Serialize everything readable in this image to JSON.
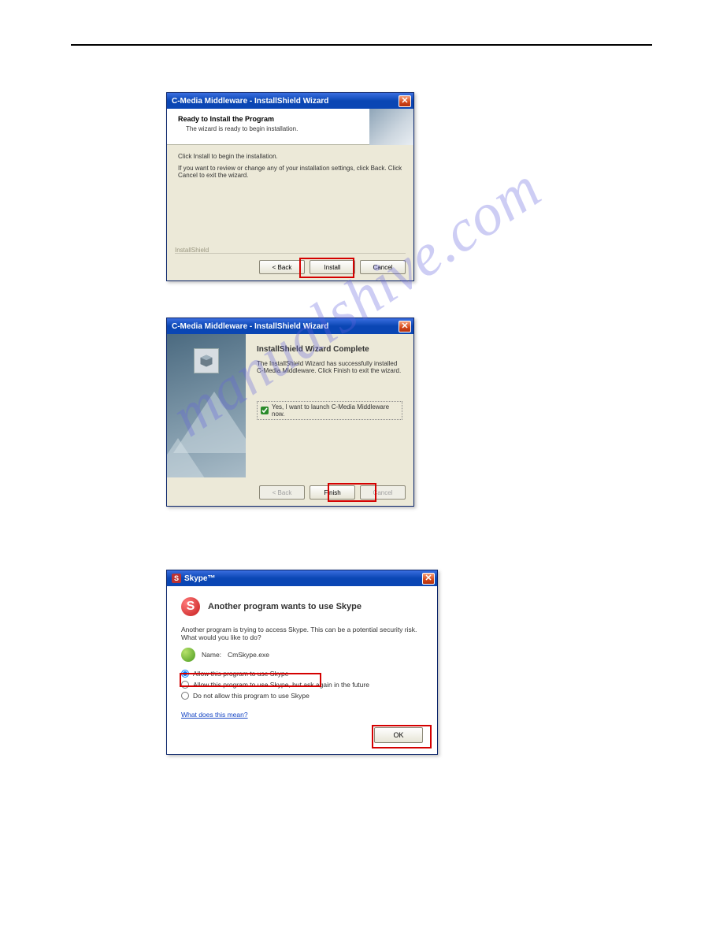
{
  "watermark": "manualshive.com",
  "dialog1": {
    "title": "C-Media Middleware - InstallShield Wizard",
    "heading": "Ready to Install the Program",
    "subheading": "The wizard is ready to begin installation.",
    "line1": "Click Install to begin the installation.",
    "line2": "If you want to review or change any of your installation settings, click Back. Click Cancel to exit the wizard.",
    "brand": "InstallShield",
    "btn_back": "< Back",
    "btn_install": "Install",
    "btn_cancel": "Cancel"
  },
  "dialog2": {
    "title": "C-Media Middleware - InstallShield Wizard",
    "heading": "InstallShield Wizard Complete",
    "body": "The InstallShield Wizard has successfully installed C-Media Middleware. Click Finish to exit the wizard.",
    "checkbox_label": "Yes, I want to launch C-Media Middleware now.",
    "btn_back": "< Back",
    "btn_finish": "Finish",
    "btn_cancel": "Cancel"
  },
  "dialog3": {
    "title": "Skype™",
    "heading": "Another program wants to use Skype",
    "intro1": "Another program is trying to access Skype. This can be a potential security risk.",
    "intro2": "What would you like to do?",
    "name_label": "Name:",
    "name_value": "CmSkype.exe",
    "opt_allow": "Allow this program to use Skype",
    "opt_ask": "Allow this program to use Skype, but ask again in the future",
    "opt_deny": "Do not allow this program to use Skype",
    "link": "What does this mean?",
    "btn_ok": "OK"
  }
}
